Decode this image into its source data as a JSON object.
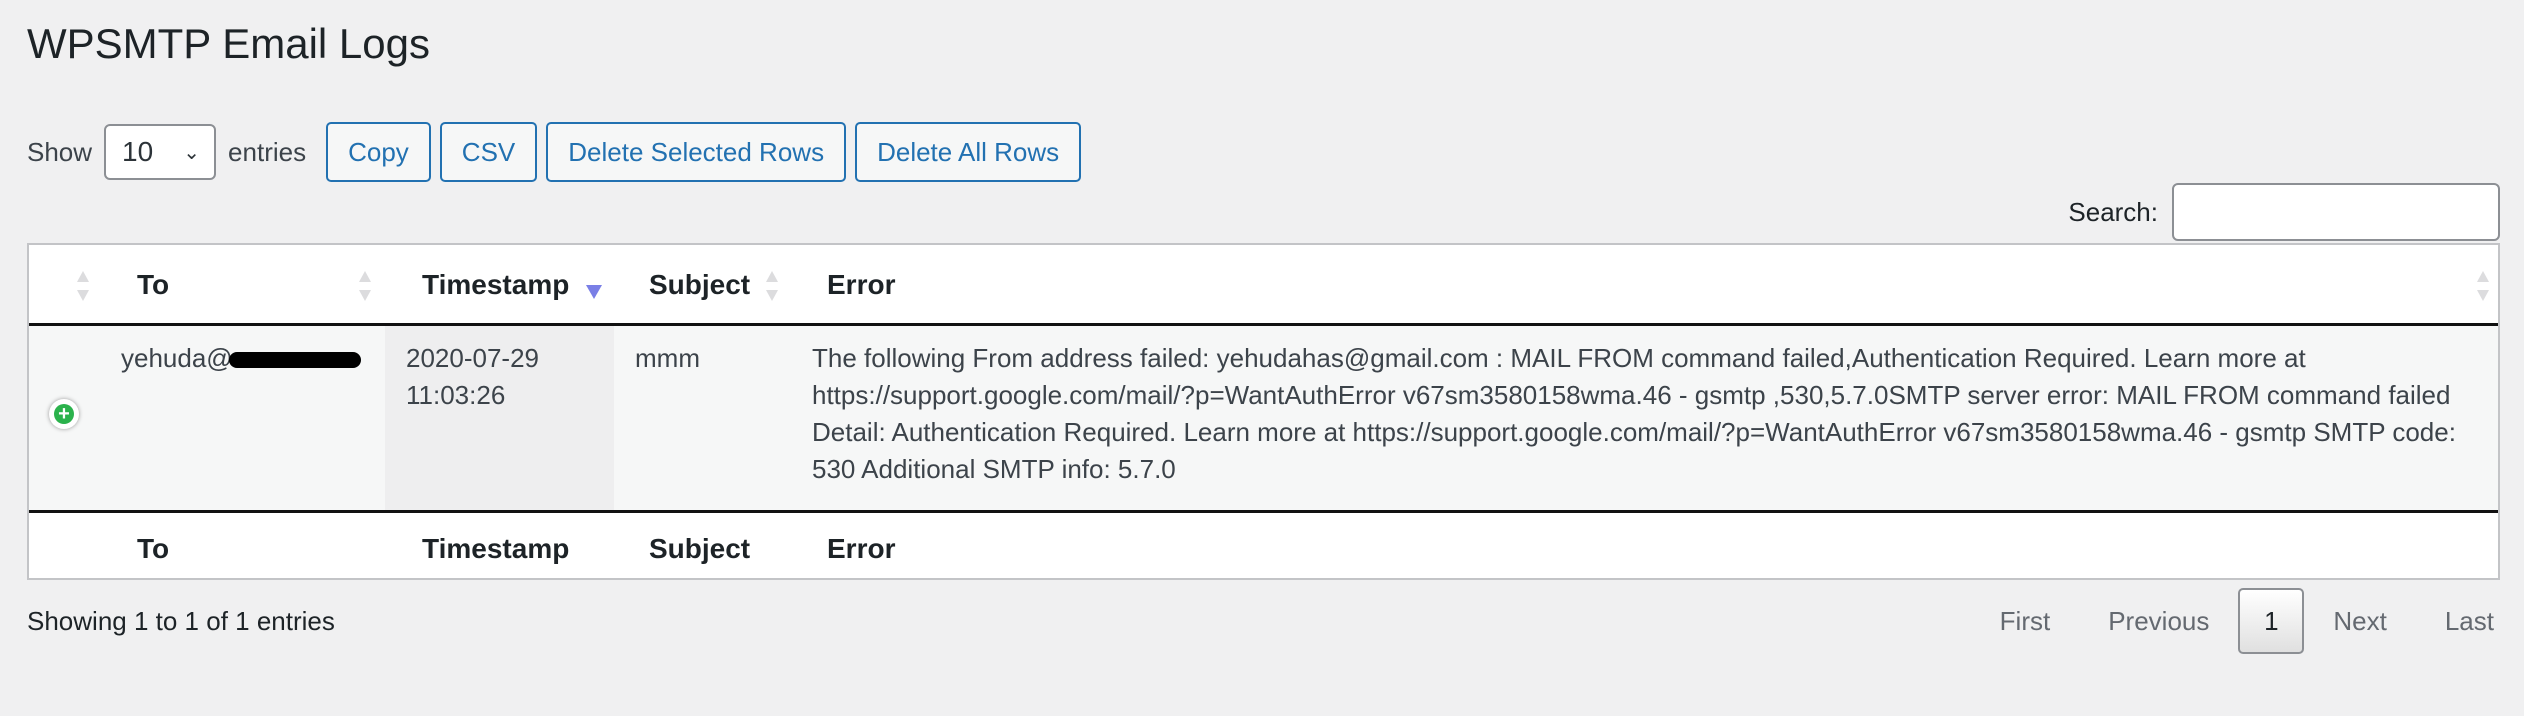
{
  "title": "WPSMTP Email Logs",
  "controls": {
    "show_label": "Show",
    "entries_value": "10",
    "entries_label": "entries",
    "buttons": [
      "Copy",
      "CSV",
      "Delete Selected Rows",
      "Delete All Rows"
    ]
  },
  "search": {
    "label": "Search:",
    "value": ""
  },
  "table": {
    "columns": [
      "To",
      "Timestamp",
      "Subject",
      "Error"
    ],
    "sorted_column": "Timestamp",
    "sort_direction": "desc",
    "rows": [
      {
        "to": "yehuda@",
        "timestamp_date": "2020-07-29",
        "timestamp_time": "11:03:26",
        "subject": "mmm",
        "error": "The following From address failed: yehudahas@gmail.com : MAIL FROM command failed,Authentication Required. Learn more at https://support.google.com/mail/?p=WantAuthError v67sm3580158wma.46 - gsmtp ,530,5.7.0SMTP server error: MAIL FROM command failed Detail: Authentication Required. Learn more at https://support.google.com/mail/?p=WantAuthError v67sm3580158wma.46 - gsmtp SMTP code: 530 Additional SMTP info: 5.7.0"
      }
    ]
  },
  "info": "Showing 1 to 1 of 1 entries",
  "pagination": {
    "first": "First",
    "previous": "Previous",
    "current": "1",
    "next": "Next",
    "last": "Last"
  },
  "colors": {
    "accent": "#2271b1",
    "expand": "#2bb24c",
    "sort_active": "#7a7fe6"
  }
}
